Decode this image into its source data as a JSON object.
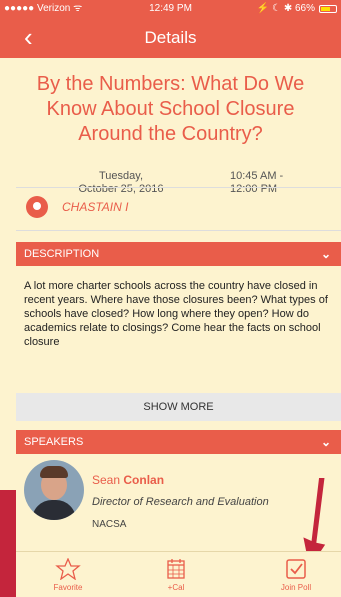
{
  "status_bar": {
    "carrier": "●●●●● Verizon ᯤ",
    "time": "12:49 PM",
    "battery_text": "⚡ ☾ ✱ 66%",
    "battery_level": 0.66
  },
  "nav": {
    "back_glyph": "‹",
    "title": "Details"
  },
  "session": {
    "title": "By the Numbers: What Do We Know About School Closure Around the Country?",
    "date_line1": "Tuesday,",
    "date_line2": "October 25, 2016",
    "time_line1": "10:45 AM -",
    "time_line2": "12:00 PM",
    "location": "CHASTAIN I"
  },
  "description": {
    "header": "DESCRIPTION",
    "text": "A lot more charter schools across the country have closed in recent years. Where have those closures been? What types of schools have closed? How long where they open? How do academics relate to closings? Come hear the facts on school closure",
    "show_more": "SHOW MORE"
  },
  "speakers": {
    "header": "SPEAKERS",
    "items": [
      {
        "first_name": "Sean",
        "last_name": "Conlan",
        "role": "Director of Research and Evaluation",
        "org": "NACSA"
      }
    ]
  },
  "tabbar": {
    "favorite": "Favorite",
    "cal": "+Cal",
    "poll": "Join Poll"
  },
  "colors": {
    "accent": "#e95d4a",
    "background": "#fdf3cf",
    "overlay": "#c4253c"
  }
}
